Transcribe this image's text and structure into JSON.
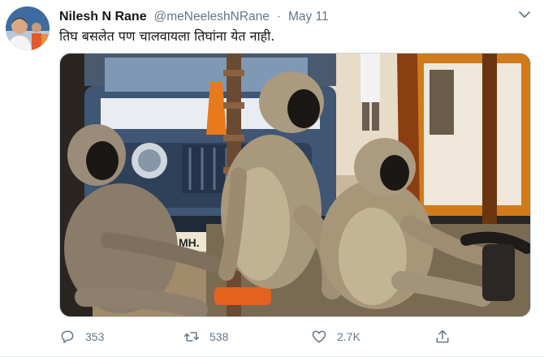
{
  "tweet": {
    "display_name": "Nilesh N Rane",
    "handle": "@meNeeleshNRane",
    "separator": "·",
    "date": "May 11",
    "text": "तिघ बसलेत पण चालवायला तिघांना येत नाही.",
    "avatar_icon": "user-avatar-photo",
    "media": {
      "description_icon": "monkeys-in-autorickshaw-photo",
      "plate_text": "MH."
    }
  },
  "actions": {
    "reply_count": "353",
    "retweet_count": "538",
    "like_count": "2.7K",
    "reply_icon": "reply-icon",
    "retweet_icon": "retweet-icon",
    "like_icon": "heart-icon",
    "share_icon": "share-icon"
  },
  "colors": {
    "text_primary": "#14171a",
    "text_secondary": "#657786",
    "border": "#ccd6dd"
  }
}
